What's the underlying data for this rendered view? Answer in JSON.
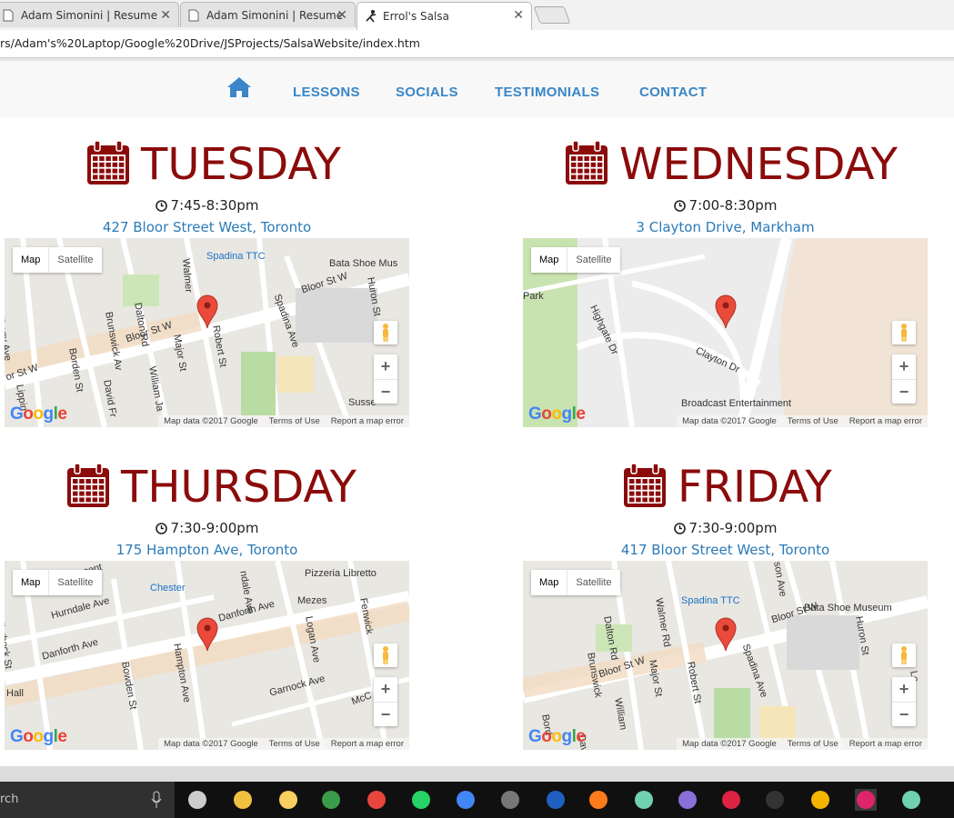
{
  "browser": {
    "tabs": [
      {
        "title": "Adam Simonini | Resume",
        "active": false
      },
      {
        "title": "Adam Simonini | Resume",
        "active": false
      },
      {
        "title": "Errol's Salsa",
        "active": true
      }
    ],
    "url": "rs/Adam's%20Laptop/Google%20Drive/JSProjects/SalsaWebsite/index.htm",
    "close_glyph": "✕"
  },
  "nav": {
    "home_icon": "home-icon",
    "items": [
      "LESSONS",
      "SOCIALS",
      "TESTIMONIALS",
      "CONTACT"
    ],
    "color": "#3a86c8"
  },
  "accent": "#8b0b0b",
  "link_color": "#2a7ab8",
  "days": [
    {
      "day": "TUESDAY",
      "time": "7:45-8:30pm",
      "location": "427 Bloor Street West, Toronto",
      "map": {
        "labels": [
          "Spadina TTC",
          "Bata Shoe Mus",
          "Bloor St W",
          "Bloor St W",
          "Dalton Rd",
          "Walmer",
          "Huron St",
          "Brunswick Av",
          "Major St",
          "Robert St",
          "Spadina Ave",
          "Borden St",
          "David Fr",
          "William Ja",
          "Albany Ave",
          "or St W",
          "Lippin",
          "Susse"
        ]
      }
    },
    {
      "day": "WEDNESDAY",
      "time": "7:00-8:30pm",
      "location": "3 Clayton Drive, Markham",
      "map": {
        "labels": [
          "Park",
          "Highgate Dr",
          "Clayton Dr",
          "Broadcast Entertainment"
        ]
      }
    },
    {
      "day": "THURSDAY",
      "time": "7:30-9:00pm",
      "location": "175 Hampton Ave, Toronto",
      "map": {
        "labels": [
          "Pizzeria Libretto",
          "Chester",
          "Mezes",
          "Hurndale Ave",
          "Danforth Ave",
          "Danforth Ave",
          "Ellerbeck St",
          "Bowden St",
          "Hampton Ave",
          "Logan Ave",
          "Garnock Ave",
          "Fenwick",
          "scent",
          "ndale Ave",
          "Hall",
          "McC"
        ]
      }
    },
    {
      "day": "FRIDAY",
      "time": "7:30-9:00pm",
      "location": "417 Bloor Street West, Toronto",
      "map": {
        "labels": [
          "Spadina TTC",
          "Bata Shoe Museum",
          "Bloor St W",
          "Bloor St W",
          "Dalton Rd",
          "Walmer Rd",
          "Huron St",
          "Brunswick",
          "Major St",
          "Robert St",
          "Spadina Ave",
          "Bord",
          "William",
          "Dav",
          "son Ave",
          "Lo"
        ]
      }
    }
  ],
  "map_ui": {
    "map_btn": "Map",
    "satellite_btn": "Satellite",
    "zoom_in": "+",
    "zoom_out": "−",
    "logo": "Google",
    "footer": [
      "Map data ©2017 Google",
      "Terms of Use",
      "Report a map error"
    ]
  },
  "taskbar": {
    "search_text": "rch",
    "icons": [
      "microphone-icon",
      "task-view-icon",
      "file-explorer-icon",
      "file-manager-icon",
      "google-drive-icon",
      "chrome-icon",
      "whatsapp-icon",
      "google-docs-icon",
      "obs-icon",
      "app-icon",
      "firefox-icon",
      "atom-icon",
      "github-icon",
      "sourcetree-icon",
      "terminal-icon",
      "chrome-canary-icon",
      "app-pink-icon",
      "atom-icon-2"
    ]
  }
}
